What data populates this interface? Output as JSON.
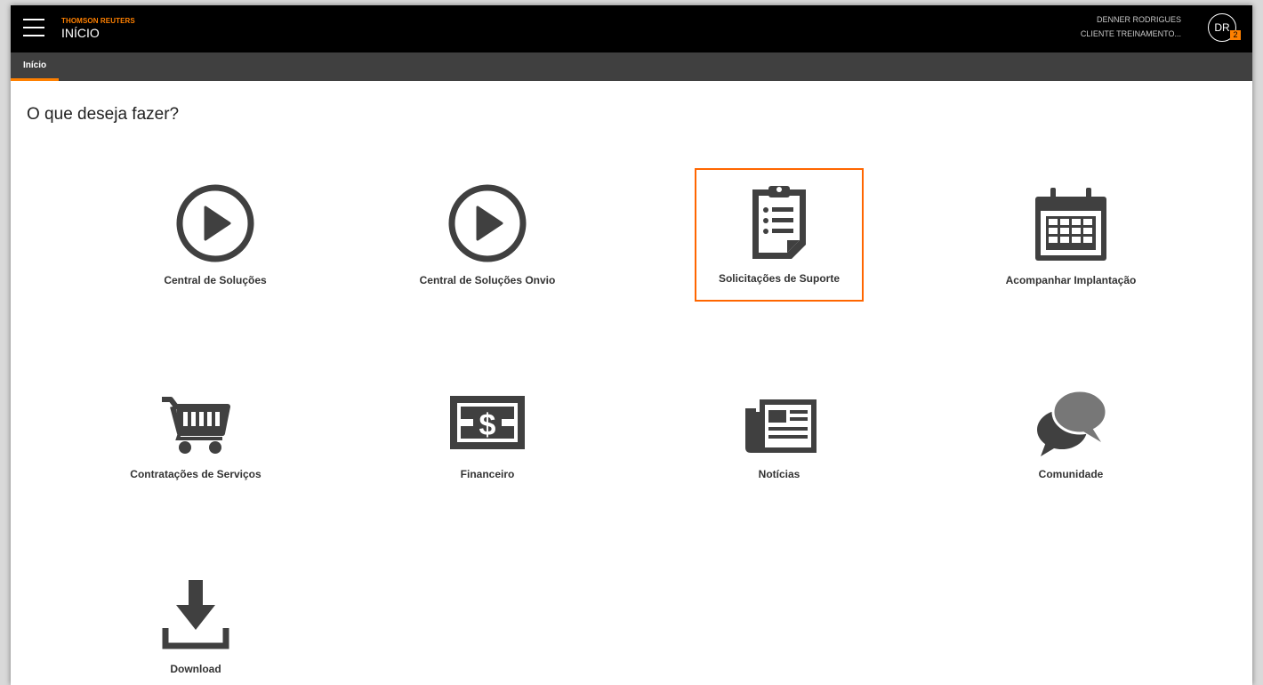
{
  "header": {
    "brand": "THOMSON REUTERS",
    "page_title": "INÍCIO",
    "user_name": "DENNER RODRIGUES",
    "user_org": "CLIENTE TREINAMENTO...",
    "avatar_initials": "DR",
    "notification_count": "2"
  },
  "tabs": [
    {
      "label": "Início",
      "active": true
    }
  ],
  "main": {
    "heading": "O que deseja fazer?",
    "tiles": [
      {
        "label": "Central de Soluções",
        "icon": "play-circle-icon"
      },
      {
        "label": "Central de Soluções Onvio",
        "icon": "play-circle-icon"
      },
      {
        "label": "Solicitações de Suporte",
        "icon": "clipboard-icon",
        "selected": true
      },
      {
        "label": "Acompanhar Implantação",
        "icon": "calendar-icon"
      },
      {
        "label": "Contratações de Serviços",
        "icon": "shopping-cart-icon"
      },
      {
        "label": "Financeiro",
        "icon": "money-bill-icon"
      },
      {
        "label": "Notícias",
        "icon": "newspaper-icon"
      },
      {
        "label": "Comunidade",
        "icon": "chat-bubbles-icon"
      },
      {
        "label": "Download",
        "icon": "download-icon"
      }
    ]
  },
  "colors": {
    "accent": "#ff8000",
    "header_bg": "#000000",
    "tabbar_bg": "#404040",
    "icon": "#404040"
  }
}
